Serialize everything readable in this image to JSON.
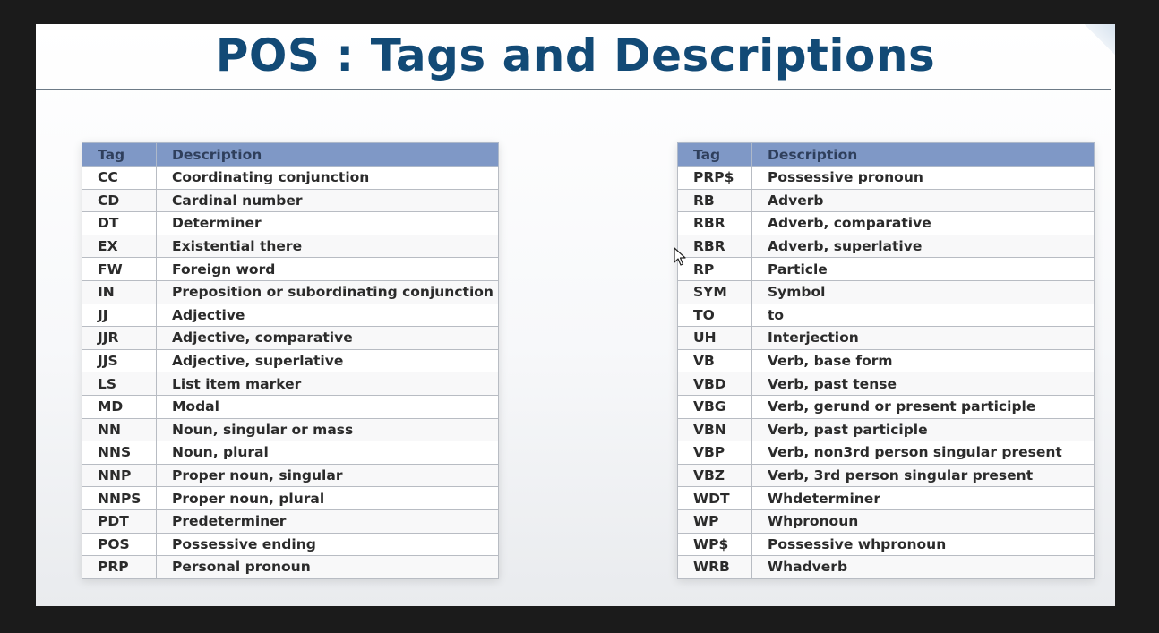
{
  "title": "POS : Tags and Descriptions",
  "headers": {
    "tag": "Tag",
    "description": "Description"
  },
  "left_table": [
    {
      "tag": "CC",
      "description": "Coordinating conjunction"
    },
    {
      "tag": "CD",
      "description": "Cardinal number"
    },
    {
      "tag": "DT",
      "description": "Determiner"
    },
    {
      "tag": "EX",
      "description": "Existential there"
    },
    {
      "tag": "FW",
      "description": "Foreign word"
    },
    {
      "tag": "IN",
      "description": "Preposition or subordinating conjunction"
    },
    {
      "tag": "JJ",
      "description": "Adjective"
    },
    {
      "tag": "JJR",
      "description": "Adjective, comparative"
    },
    {
      "tag": "JJS",
      "description": "Adjective, superlative"
    },
    {
      "tag": "LS",
      "description": "List item marker"
    },
    {
      "tag": "MD",
      "description": "Modal"
    },
    {
      "tag": "NN",
      "description": "Noun, singular or mass"
    },
    {
      "tag": "NNS",
      "description": "Noun, plural"
    },
    {
      "tag": "NNP",
      "description": "Proper noun, singular"
    },
    {
      "tag": "NNPS",
      "description": "Proper noun, plural"
    },
    {
      "tag": "PDT",
      "description": "Predeterminer"
    },
    {
      "tag": "POS",
      "description": "Possessive ending"
    },
    {
      "tag": "PRP",
      "description": "Personal pronoun"
    }
  ],
  "right_table": [
    {
      "tag": "PRP$",
      "description": "Possessive pronoun"
    },
    {
      "tag": "RB",
      "description": "Adverb"
    },
    {
      "tag": "RBR",
      "description": "Adverb, comparative"
    },
    {
      "tag": "RBR",
      "description": "Adverb, superlative"
    },
    {
      "tag": "RP",
      "description": "Particle"
    },
    {
      "tag": "SYM",
      "description": "Symbol"
    },
    {
      "tag": "TO",
      "description": "to"
    },
    {
      "tag": "UH",
      "description": "Interjection"
    },
    {
      "tag": "VB",
      "description": "Verb, base form"
    },
    {
      "tag": "VBD",
      "description": "Verb, past tense"
    },
    {
      "tag": "VBG",
      "description": "Verb, gerund or present participle"
    },
    {
      "tag": "VBN",
      "description": "Verb, past participle"
    },
    {
      "tag": "VBP",
      "description": "Verb, non3rd person singular present"
    },
    {
      "tag": "VBZ",
      "description": "Verb, 3rd person singular present"
    },
    {
      "tag": "WDT",
      "description": "Whdeterminer"
    },
    {
      "tag": "WP",
      "description": "Whpronoun"
    },
    {
      "tag": "WP$",
      "description": "Possessive whpronoun"
    },
    {
      "tag": "WRB",
      "description": "Whadverb"
    }
  ],
  "colors": {
    "title": "#124a76",
    "header_bg": "#7f98c6",
    "header_text": "#2f3f5c"
  },
  "icons": {
    "pointer": "mouse-pointer-icon"
  }
}
